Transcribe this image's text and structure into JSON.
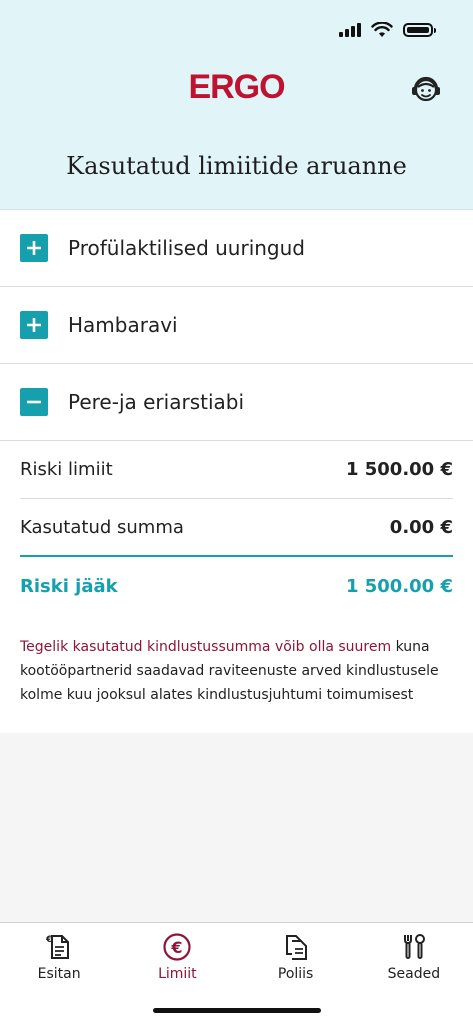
{
  "header": {
    "logo": "ERGO",
    "title": "Kasutatud limiitide aruanne",
    "support_icon": "support-agent-icon"
  },
  "colors": {
    "brand_red": "#bf1230",
    "accent_teal": "#16a0ae",
    "header_bg": "#e1f4f8",
    "active_tab": "#8e1537"
  },
  "accordion": [
    {
      "label": "Profülaktilised uuringud",
      "state": "collapsed",
      "icon": "plus-icon"
    },
    {
      "label": "Hambaravi",
      "state": "collapsed",
      "icon": "plus-icon"
    },
    {
      "label": "Pere-ja eriarstiabi",
      "state": "expanded",
      "icon": "minus-icon"
    }
  ],
  "limits": {
    "rows": [
      {
        "label": "Riski limiit",
        "value": "1 500.00 €"
      },
      {
        "label": "Kasutatud summa",
        "value": "0.00 €"
      }
    ],
    "remaining": {
      "label": "Riski jääk",
      "value": "1 500.00 €"
    }
  },
  "note": {
    "highlight": "Tegelik kasutatud kindlustussumma võib olla suurem",
    "text": " kuna kootööpartnerid saadavad raviteenuste arved kindlustusele kolme kuu jooksul alates kindlustusjuhtumi toimumisest"
  },
  "tabbar": [
    {
      "label": "Esitan",
      "icon": "document-euro-icon",
      "active": false
    },
    {
      "label": "Limiit",
      "icon": "euro-circle-icon",
      "active": true
    },
    {
      "label": "Poliis",
      "icon": "documents-icon",
      "active": false
    },
    {
      "label": "Seaded",
      "icon": "tools-icon",
      "active": false
    }
  ]
}
